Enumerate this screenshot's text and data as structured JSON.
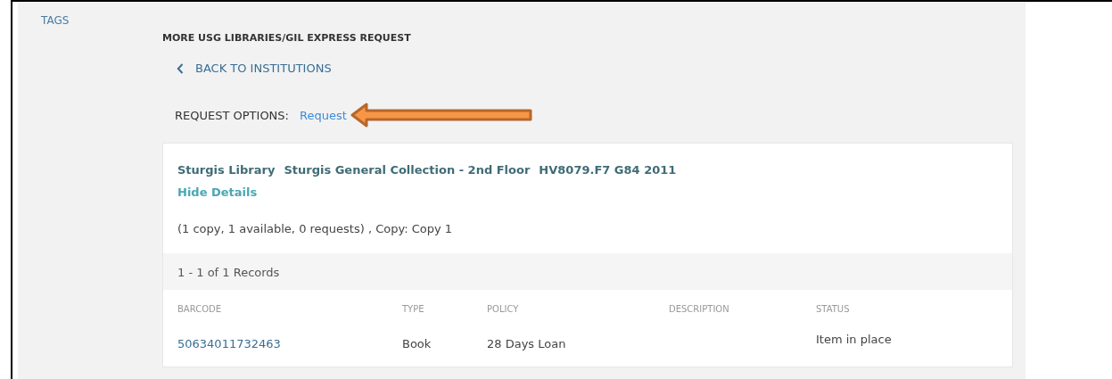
{
  "tags_link": "TAGS",
  "section_title": "MORE USG LIBRARIES/GIL EXPRESS REQUEST",
  "back_link": {
    "label": "BACK TO INSTITUTIONS"
  },
  "request_options": {
    "label": "REQUEST OPTIONS:",
    "link": "Request"
  },
  "holding": {
    "library": "Sturgis Library",
    "location": "Sturgis General Collection - 2nd Floor",
    "call_number": "HV8079.F7 G84 2011",
    "toggle": "Hide Details",
    "summary": "(1 copy, 1 available, 0 requests) ,  Copy: Copy 1"
  },
  "records_count": "1 - 1 of 1 Records",
  "table": {
    "columns": [
      "BARCODE",
      "TYPE",
      "POLICY",
      "DESCRIPTION",
      "STATUS"
    ],
    "rows": [
      {
        "cells": [
          "50634011732463",
          "Book",
          "28 Days Loan",
          "",
          "Item in place"
        ]
      }
    ]
  }
}
